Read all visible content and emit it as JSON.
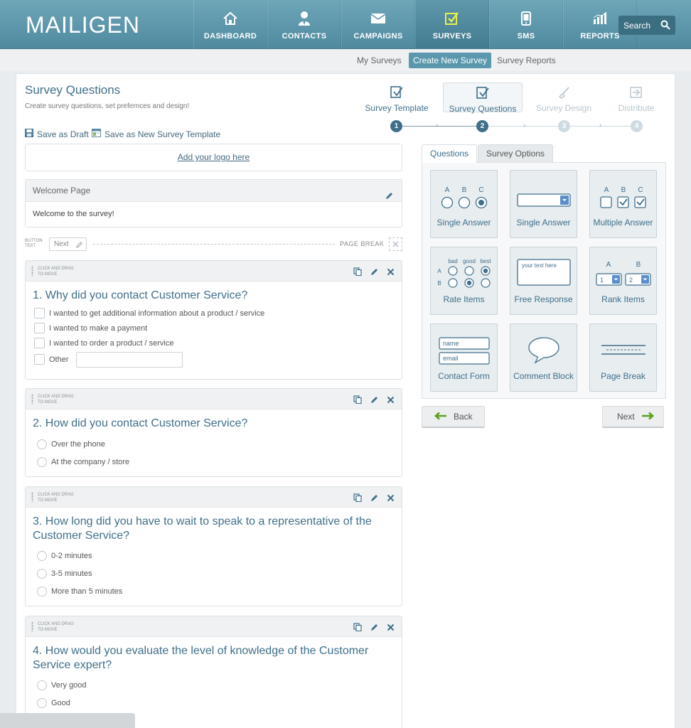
{
  "header": {
    "logo": "MAILIGEN",
    "nav": [
      {
        "label": "DASHBOARD",
        "icon": "home-icon"
      },
      {
        "label": "CONTACTS",
        "icon": "person-icon"
      },
      {
        "label": "CAMPAIGNS",
        "icon": "envelope-icon"
      },
      {
        "label": "SURVEYS",
        "icon": "checkbox-icon",
        "active": true
      },
      {
        "label": "SMS",
        "icon": "phone-icon"
      },
      {
        "label": "REPORTS",
        "icon": "bar-chart-icon"
      }
    ],
    "search_label": "Search"
  },
  "subnav": {
    "my_surveys": "My Surveys",
    "create_new": "Create New Survey",
    "reports": "Survey Reports"
  },
  "page": {
    "title": "Survey Questions",
    "subtitle": "Create survey questions, set prefernces and design!",
    "save_draft": "Save as Draft",
    "save_template": "Save as New Survey Template"
  },
  "steps": [
    {
      "label": "Survey Template",
      "num": "1",
      "state": "done"
    },
    {
      "label": "Survey Questions",
      "num": "2",
      "state": "active"
    },
    {
      "label": "Survey Design",
      "num": "3",
      "state": "disabled"
    },
    {
      "label": "Distribute",
      "num": "4",
      "state": "disabled"
    }
  ],
  "logo_placeholder": "Add your logo here",
  "welcome": {
    "header": "Welcome Page",
    "text": "Welcome to the survey!"
  },
  "page_break": {
    "button_text_label": "BUTTON TEXT",
    "next_label": "Next",
    "label": "PAGE BREAK"
  },
  "drag_text": "CLICK AND DRAG TO MOVE",
  "questions": [
    {
      "title": "1. Why did you contact Customer Service?",
      "type": "checkbox",
      "options": [
        "I wanted to get additional information about a product / service",
        "I wanted to make a payment",
        "I wanted to order a product / service",
        "Other"
      ]
    },
    {
      "title": "2. How did you contact Customer Service?",
      "type": "radio",
      "options": [
        "Over the phone",
        "At the company / store"
      ]
    },
    {
      "title": "3. How long did you have to wait to speak to a representative of the Customer Service?",
      "type": "radio",
      "options": [
        "0-2 minutes",
        "3-5 minutes",
        "More than 5 minutes"
      ]
    },
    {
      "title": "4. How would you evaluate the level of knowledge of the Customer Service expert?",
      "type": "radio",
      "options": [
        "Very good",
        "Good"
      ]
    }
  ],
  "tabs": {
    "questions": "Questions",
    "options": "Survey Options"
  },
  "palette": {
    "single_answer_radio": "Single Answer",
    "single_answer_select": "Single Answer",
    "multiple_answer": "Multiple Answer",
    "rate_items": "Rate Items",
    "free_response": "Free Response",
    "rank_items": "Rank Items",
    "contact_form": "Contact Form",
    "comment_block": "Comment Block",
    "page_break": "Page Break",
    "abc": [
      "A",
      "B",
      "C"
    ],
    "rate_cols": [
      "bad",
      "good",
      "best"
    ],
    "rate_rows": [
      "A",
      "B"
    ],
    "free_placeholder": "your text here",
    "rank_cols": [
      "A",
      "B"
    ],
    "rank_vals": [
      "1",
      "2"
    ],
    "contact_fields": [
      "name",
      "email"
    ]
  },
  "buttons": {
    "back": "Back",
    "next": "Next"
  },
  "colors": {
    "accent": "#3f6f8a",
    "header": "#5b98ad",
    "green_arrow": "#5aa11f"
  }
}
